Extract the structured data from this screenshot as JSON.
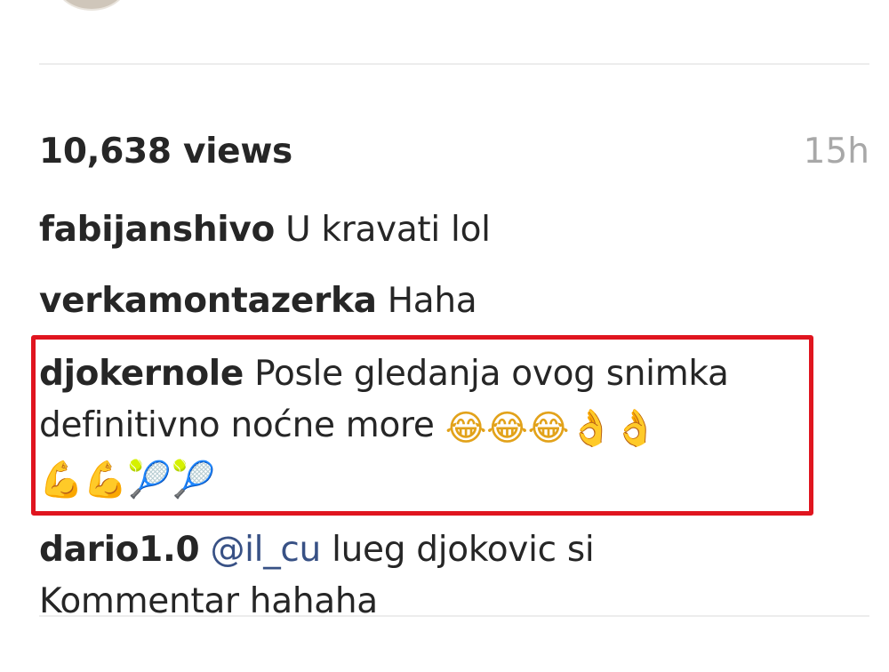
{
  "post": {
    "views": "10,638 views",
    "time": "15h"
  },
  "comments": [
    {
      "user": "fabijanshivo",
      "text": "U kravati lol"
    },
    {
      "user": "verkamontazerka",
      "text": "Haha"
    },
    {
      "user": "djokernole",
      "text": "Posle gledanja ovog snimka definitivno noćne more",
      "emojis": [
        "😂",
        "😂",
        "😂",
        "👌",
        "👌",
        "💪",
        "💪",
        "🎾",
        "🎾"
      ]
    },
    {
      "user": "dario1.0",
      "mention": "@il_cu",
      "text": "lueg djokovic si Kommentar hahaha"
    }
  ],
  "colors": {
    "highlight": "#e0151f",
    "mention": "#385185",
    "muted": "#a8a8a8"
  }
}
